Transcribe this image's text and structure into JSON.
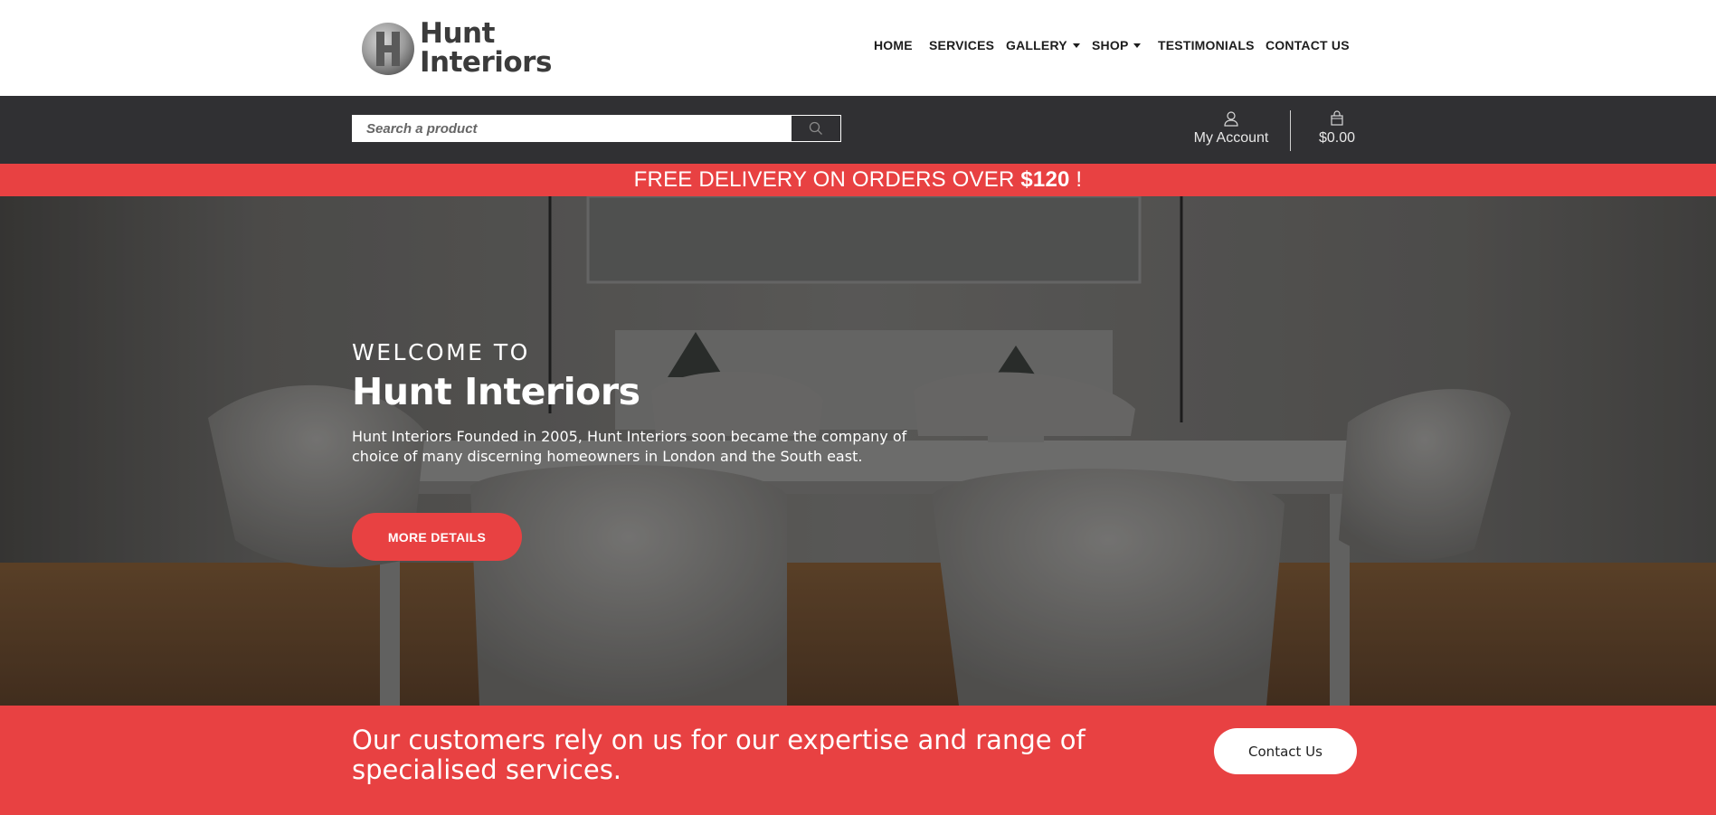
{
  "brand": {
    "name_line1": "Hunt",
    "name_line2": "Interiors",
    "accent_color": "#e84142",
    "dark_color": "#303033"
  },
  "nav": {
    "items": [
      {
        "label": "HOME",
        "has_dropdown": false
      },
      {
        "label": "SERVICES",
        "has_dropdown": false
      },
      {
        "label": "GALLERY",
        "has_dropdown": true
      },
      {
        "label": "SHOP",
        "has_dropdown": true
      },
      {
        "label": "TESTIMONIALS",
        "has_dropdown": false
      },
      {
        "label": "CONTACT US",
        "has_dropdown": false
      }
    ]
  },
  "utility": {
    "search_placeholder": "Search a product",
    "search_icon": "search-icon",
    "account_label": "My Account",
    "account_icon": "user-icon",
    "cart_total": "$0.00",
    "cart_icon": "shopping-bag-icon"
  },
  "promo": {
    "text_before": "FREE DELIVERY ON ORDERS OVER ",
    "amount": "$120",
    "text_after": " !"
  },
  "hero": {
    "welcome": "WELCOME TO",
    "title": "Hunt Interiors",
    "description": "Hunt Interiors Founded in 2005, Hunt Interiors soon became the company of choice of many discerning homeowners in London and the South east.",
    "button_label": "MORE DETAILS"
  },
  "cta": {
    "text": "Our customers rely on us for our expertise and range of specialised services.",
    "button_label": "Contact Us"
  }
}
